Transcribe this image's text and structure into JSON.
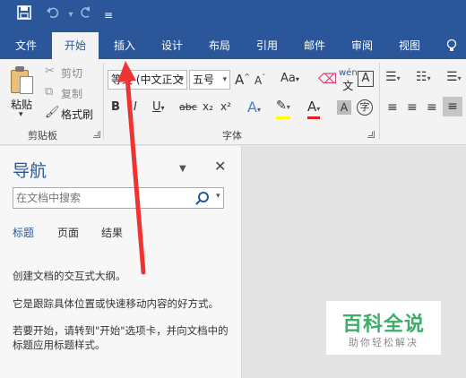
{
  "titlebar": {
    "save_icon": "save-icon",
    "undo_icon": "undo-icon",
    "redo_icon": "redo-icon",
    "customize_icon": "customize-qat-icon"
  },
  "tabs": [
    "文件",
    "开始",
    "插入",
    "设计",
    "布局",
    "引用",
    "邮件",
    "审阅",
    "视图"
  ],
  "ribbon": {
    "clipboard": {
      "paste": "粘贴",
      "cut": "剪切",
      "copy": "复制",
      "format_painter": "格式刷",
      "group_label": "剪贴板"
    },
    "font": {
      "font_name": "等线 (中文正文",
      "font_size": "五号",
      "grow": "A",
      "shrink": "A",
      "change_case": "Aa",
      "phonetic": "wén",
      "border_char": "A",
      "bold": "B",
      "italic": "I",
      "underline": "U",
      "strikethrough": "abc",
      "subscript": "x₂",
      "superscript": "x²",
      "group_label": "字体",
      "highlight_color": "#ffff00",
      "font_color": "#e02020"
    }
  },
  "nav": {
    "title": "导航",
    "search_placeholder": "在文档中搜索",
    "tabs": [
      "标题",
      "页面",
      "结果"
    ],
    "line1": "创建文档的交互式大纲。",
    "line2": "它是跟踪具体位置或快速移动内容的好方式。",
    "line3": "若要开始，请转到\"开始\"选项卡，并向文档中的标题应用标题样式。"
  },
  "watermark": {
    "main": "百科全说",
    "sub": "助你轻松解决"
  },
  "colors": {
    "accent": "#2b579a",
    "arrow": "#ee3333",
    "watermark": "#3cae6a"
  }
}
